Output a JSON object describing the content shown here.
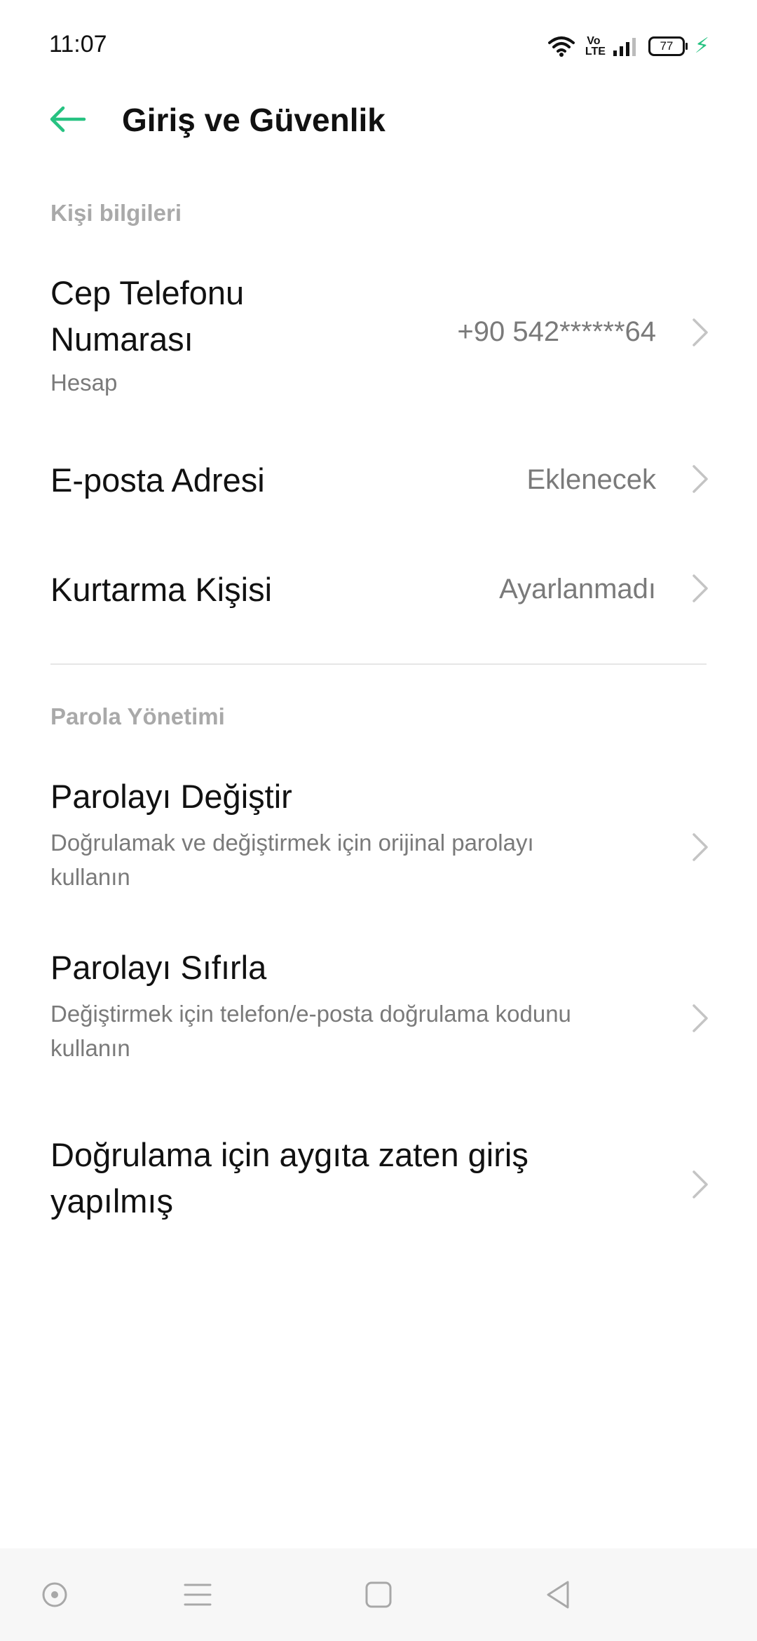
{
  "status_bar": {
    "time": "11:07",
    "volte_label": "Vo\nLTE",
    "battery_level": "77",
    "icons": [
      "wifi-icon",
      "volte-icon",
      "signal-icon",
      "battery-icon",
      "charging-icon"
    ],
    "charging_color": "#26c281"
  },
  "app_bar": {
    "back_icon": "arrow-left-icon",
    "title": "Giriş ve Güvenlik",
    "accent_color": "#26c281"
  },
  "sections": {
    "personal": {
      "header": "Kişi bilgileri",
      "phone": {
        "title_line1": "Cep Telefonu",
        "title_line2": "Numarası",
        "subtitle": "Hesap",
        "value": "+90 542******64"
      },
      "email": {
        "title": "E-posta Adresi",
        "value": "Eklenecek"
      },
      "recovery": {
        "title": "Kurtarma Kişisi",
        "value": "Ayarlanmadı"
      }
    },
    "password": {
      "header": "Parola Yönetimi",
      "change": {
        "title": "Parolayı Değiştir",
        "subtitle_line1": "Doğrulamak ve değiştirmek için orijinal parolayı",
        "subtitle_line2": "kullanın"
      },
      "reset": {
        "title": "Parolayı Sıfırla",
        "subtitle_line1": "Değiştirmek için telefon/e-posta doğrulama kodunu",
        "subtitle_line2": "kullanın"
      },
      "device": {
        "title_line1": "Doğrulama için aygıta zaten giriş",
        "title_line2": "yapılmış"
      }
    }
  },
  "nav_bar": {
    "icons": [
      "assistant-icon",
      "menu-icon",
      "home-icon",
      "back-triangle-icon"
    ]
  }
}
